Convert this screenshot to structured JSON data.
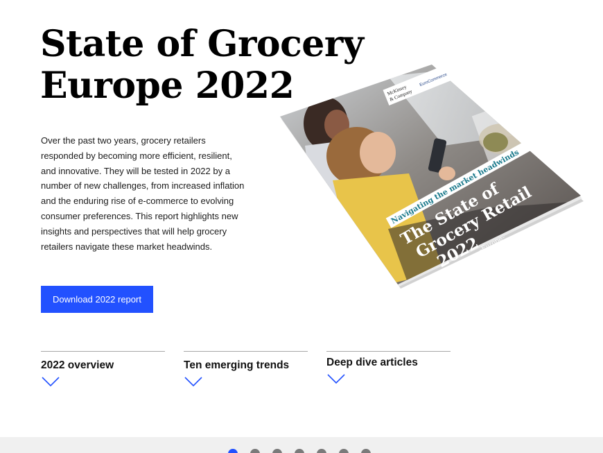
{
  "hero": {
    "title_line1": "State of Grocery",
    "title_line2": "Europe 2022",
    "intro": "Over the past two years, grocery retailers responded by becoming more efficient, resilient, and innovative. They will be tested in 2022 by a number of new challenges, from increased inflation and the enduring rise of e-commerce to evolving consumer preferences. This report highlights new insights and perspectives that will help grocery retailers navigate these market headwinds.",
    "download_label": "Download 2022 report"
  },
  "cover": {
    "logo_text_1": "McKinsey",
    "logo_text_2": "& Company",
    "logo_text_3": "EuroCommerce",
    "banner": "Navigating the market headwinds",
    "title_line1": "The State of",
    "title_line2": "Grocery Retail",
    "title_line3": "2022",
    "subtitle": "–Europe–"
  },
  "sections": [
    {
      "label": "2022 overview",
      "icon": "chevron-down-icon"
    },
    {
      "label": "Ten emerging trends",
      "icon": "chevron-down-icon"
    },
    {
      "label": "Deep dive articles",
      "icon": "chevron-down-icon"
    }
  ],
  "carousel": {
    "active_index": 0,
    "count": 7
  },
  "colors": {
    "accent": "#2251ff",
    "divider": "#a6a6a6",
    "footer_bg": "#f0f0f0",
    "chevron": "#2251ff",
    "banner_text": "#1b7a8c"
  }
}
